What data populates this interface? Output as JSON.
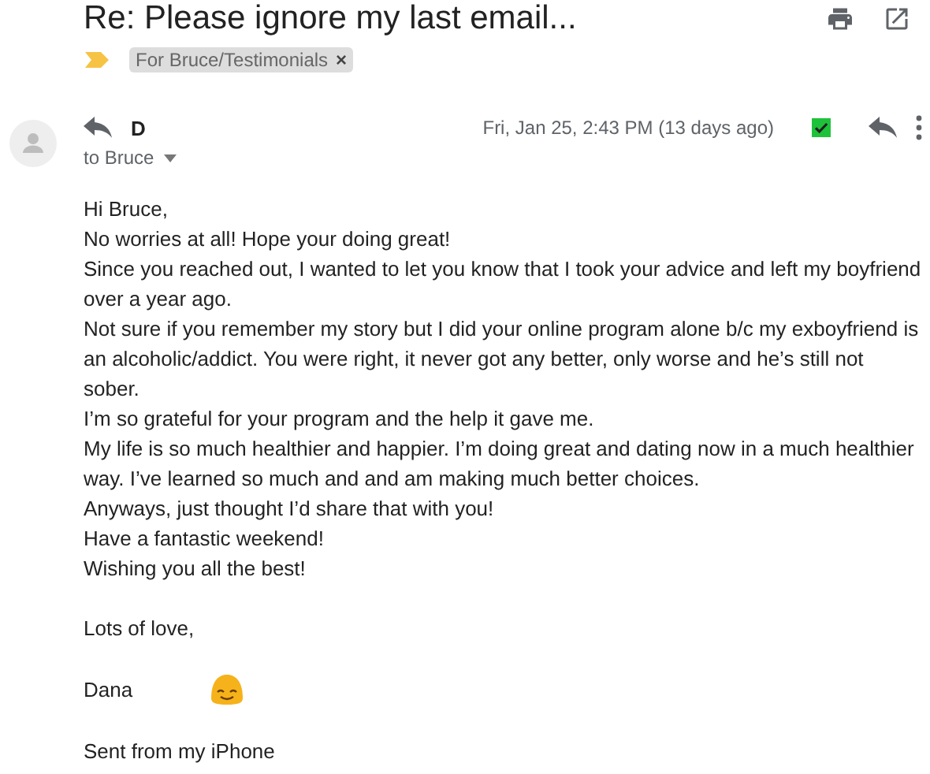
{
  "subject": "Re: Please ignore my last email...",
  "important": true,
  "labels": [
    {
      "text": "For Bruce/Testimonials",
      "close": "×"
    }
  ],
  "message": {
    "sender": "D",
    "recipient": "to Bruce",
    "date": "Fri, Jan 25, 2:43 PM (13 days ago)",
    "checked": true
  },
  "body": [
    [
      "Hi Bruce,",
      "No worries at all! Hope your doing great!",
      "Since you reached out, I wanted to let you know that I took your advice and left my boyfriend over a year ago.",
      "Not sure if you remember my story but I did your online program alone b/c my exboyfriend is an alcoholic/addict. You were right, it never got any better, only worse and he’s still not sober.",
      "I’m so grateful for your program and the help it gave me.",
      "My life is so much healthier and happier. I’m doing great and dating now in a much healthier way. I’ve learned so much and and am making much better choices.",
      "Anyways, just thought I’d share that with you!",
      "Have a fantastic weekend!",
      "Wishing you all the best!"
    ],
    [
      "Lots of love,"
    ]
  ],
  "signature": "Dana",
  "footer": "Sent from my iPhone"
}
